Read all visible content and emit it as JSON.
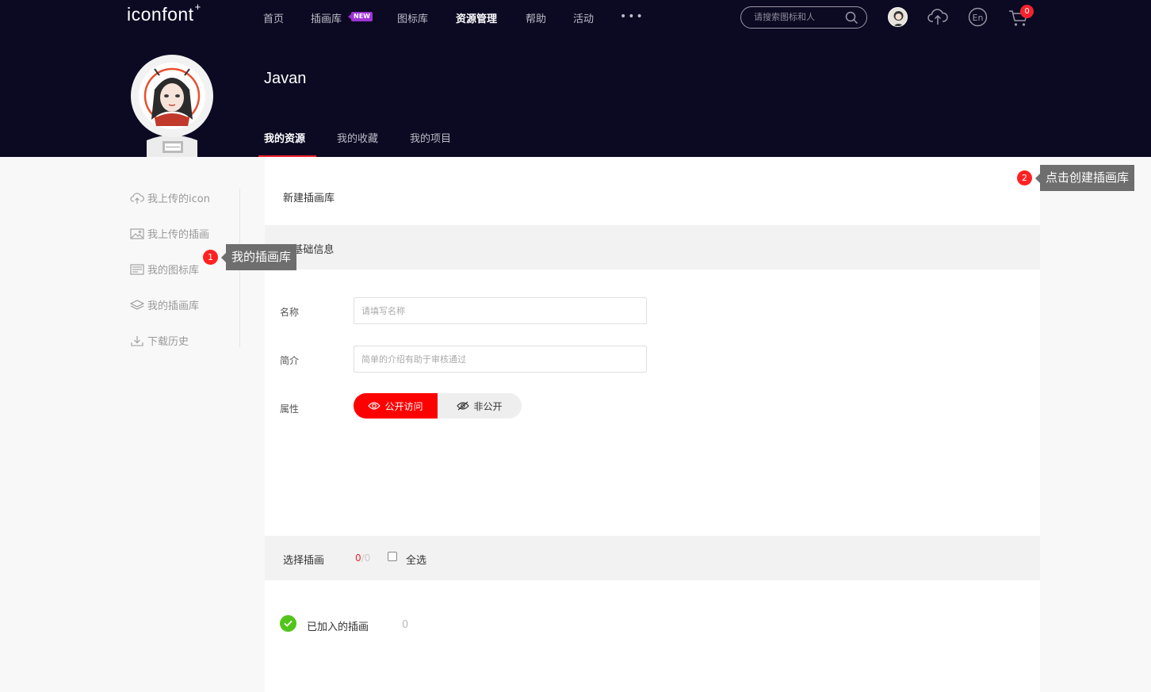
{
  "header": {
    "logo": "iconfont",
    "logo_mark": "+",
    "nav": [
      {
        "label": "首页"
      },
      {
        "label": "插画库"
      },
      {
        "label": "图标库"
      },
      {
        "label": "资源管理"
      },
      {
        "label": "帮助"
      },
      {
        "label": "活动"
      }
    ],
    "new_badge": "NEW",
    "more": "•••",
    "search_placeholder": "请搜索图标和人",
    "lang_button": "En",
    "cart_count": "0",
    "icons": [
      "upload-cloud-icon",
      "language-icon",
      "cart-icon",
      "search-icon",
      "more-icon"
    ]
  },
  "profile": {
    "username": "Javan",
    "tabs": [
      {
        "label": "我的资源",
        "active": true
      },
      {
        "label": "我的收藏",
        "active": false
      },
      {
        "label": "我的项目",
        "active": false
      }
    ]
  },
  "sidebar": {
    "items": [
      {
        "label": "我上传的icon",
        "icon": "cloud-upload-icon"
      },
      {
        "label": "我上传的插画",
        "icon": "image-icon"
      },
      {
        "label": "我的图标库",
        "icon": "library-icon"
      },
      {
        "label": "我的插画库",
        "icon": "layers-icon"
      },
      {
        "label": "下载历史",
        "icon": "download-icon"
      }
    ]
  },
  "main": {
    "title": "新建插画库",
    "section_basic": "1.基础信息",
    "name_label": "名称",
    "name_placeholder": "请填写名称",
    "intro_label": "简介",
    "intro_placeholder": "简单的介绍有助于审核通过",
    "attr_label": "属性",
    "public_label": "公开访问",
    "private_label": "非公开",
    "select_section": "选择插画",
    "selected_count": "0",
    "total_count": "/0",
    "select_all_label": "全选",
    "added_label": "已加入的插画",
    "added_count": "0"
  },
  "guides": [
    {
      "number": "1",
      "text": "我的插画库"
    },
    {
      "number": "2",
      "text": "点击创建插画库"
    }
  ],
  "colors": {
    "header_bg": "#0c0923",
    "accent_red": "#f5222d",
    "toggle_red": "#ff0000",
    "success_green": "#52c41a"
  }
}
